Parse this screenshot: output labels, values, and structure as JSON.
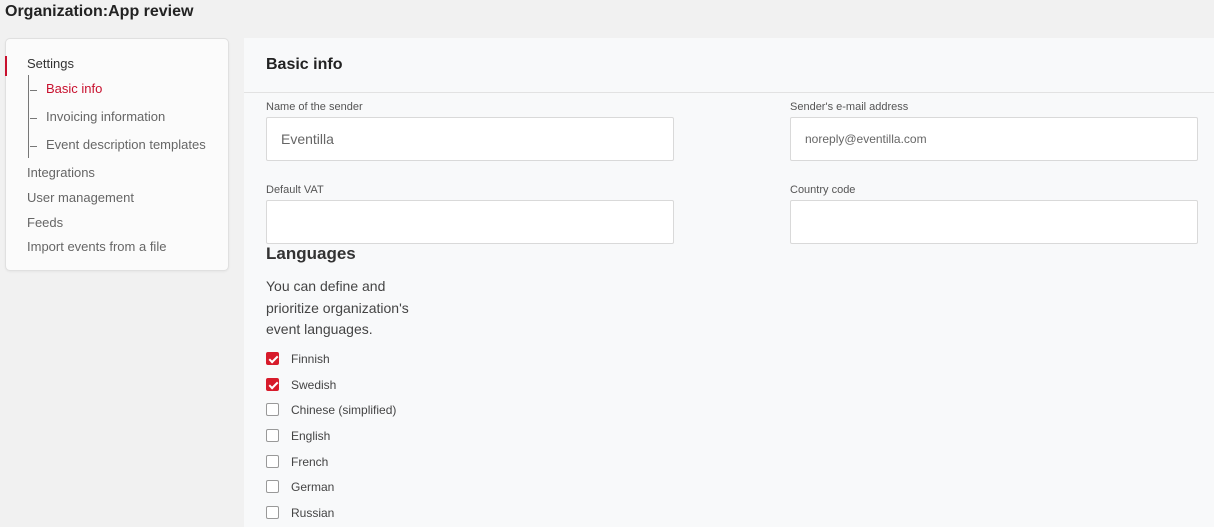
{
  "page": {
    "title": "Organization:App review"
  },
  "sidebar": {
    "heading": "Settings",
    "sub_items": [
      {
        "label": "Basic info",
        "active": true
      },
      {
        "label": "Invoicing information",
        "active": false
      },
      {
        "label": "Event description templates",
        "active": false
      }
    ],
    "items": [
      {
        "label": "Integrations"
      },
      {
        "label": "User management"
      },
      {
        "label": "Feeds"
      },
      {
        "label": "Import events from a file"
      }
    ]
  },
  "main": {
    "title": "Basic info",
    "fields": {
      "sender_name": {
        "label": "Name of the sender",
        "value": "Eventilla"
      },
      "sender_email": {
        "label": "Sender's e-mail address",
        "value": "noreply@eventilla.com"
      },
      "default_vat": {
        "label": "Default VAT",
        "value": ""
      },
      "country_code": {
        "label": "Country code",
        "value": ""
      }
    },
    "languages": {
      "title": "Languages",
      "description": "You can define and prioritize organization's event languages.",
      "options": [
        {
          "label": "Finnish",
          "checked": true
        },
        {
          "label": "Swedish",
          "checked": true
        },
        {
          "label": "Chinese (simplified)",
          "checked": false
        },
        {
          "label": "English",
          "checked": false
        },
        {
          "label": "French",
          "checked": false
        },
        {
          "label": "German",
          "checked": false
        },
        {
          "label": "Russian",
          "checked": false
        }
      ]
    }
  },
  "colors": {
    "accent": "#c8102e",
    "checkbox_checked": "#d71b2b"
  }
}
